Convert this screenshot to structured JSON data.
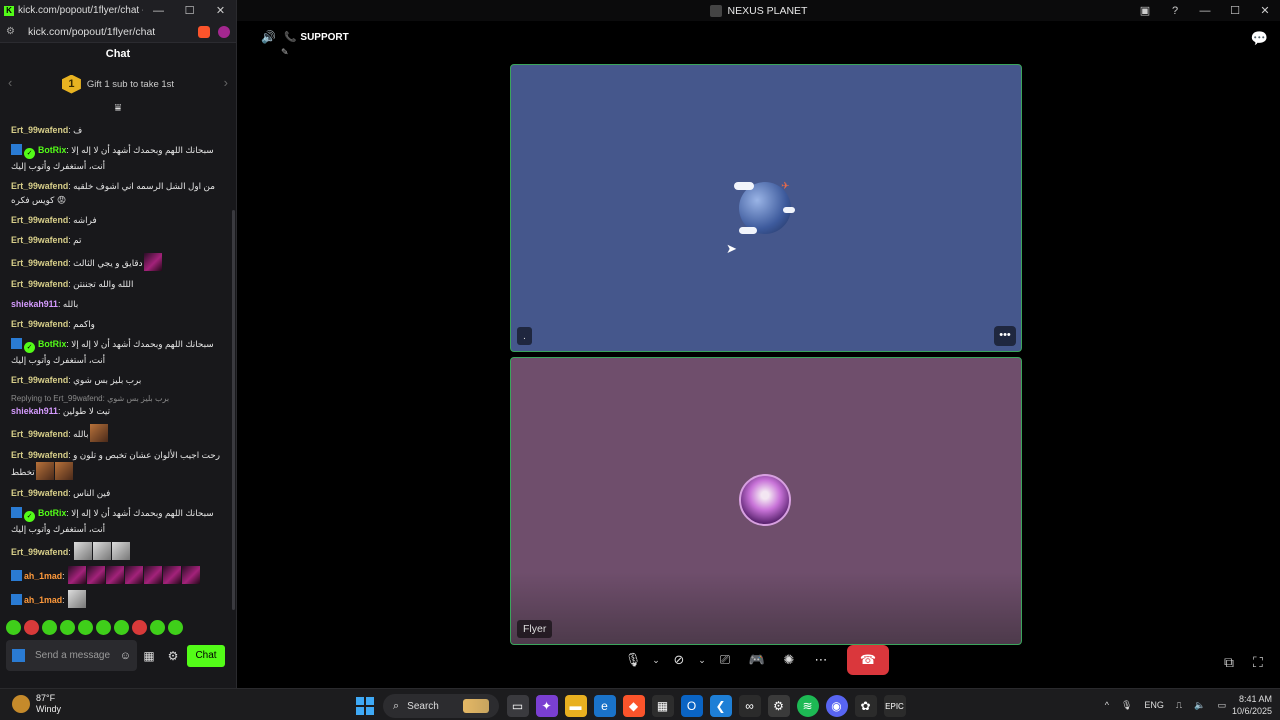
{
  "chat_window": {
    "title": "kick.com/popout/1flyer/chat - Brave",
    "url": "kick.com/popout/1flyer/chat",
    "header": "Chat",
    "pinned": {
      "icon_number": "1",
      "text": "Gift 1 sub to take 1st"
    },
    "messages": [
      {
        "user": "Ert_99wafend",
        "color": "olive",
        "text": "ف"
      },
      {
        "user": "BotRix",
        "color": "bot",
        "text": "سبحانك اللهم وبحمدك أشهد أن لا إله إلا أنت، أستغفرك وأتوب إليك",
        "badges": true
      },
      {
        "user": "Ert_99wafend",
        "color": "olive",
        "text": "من اول الشل الرسمه اني اشوف خلقيه كويس فكره 😡"
      },
      {
        "user": "Ert_99wafend",
        "color": "olive",
        "text": "فراشه"
      },
      {
        "user": "Ert_99wafend",
        "color": "olive",
        "text": "تم"
      },
      {
        "user": "Ert_99wafend",
        "color": "olive",
        "text": "دقايق و يجي الثالث",
        "emotes": 1
      },
      {
        "user": "Ert_99wafend",
        "color": "olive",
        "text": "اللله والله تجننتن"
      },
      {
        "user": "shiekah911",
        "color": "pink",
        "text": "بالله"
      },
      {
        "user": "Ert_99wafend",
        "color": "olive",
        "text": "واكمم"
      },
      {
        "user": "BotRix",
        "color": "bot",
        "text": "سبحانك اللهم وبحمدك أشهد أن لا إله إلا أنت، أستغفرك وأتوب إليك",
        "badges": true
      },
      {
        "user": "Ert_99wafend",
        "color": "olive",
        "text": "برب بليز بس شوي"
      },
      {
        "user": "shiekah911",
        "color": "pink",
        "text": "تيت لا طولين",
        "reply": "Replying to Ert_99wafend: برب بليز بس شوي"
      },
      {
        "user": "Ert_99wafend",
        "color": "olive",
        "text": "بالله",
        "emotes": 1,
        "emote_style": "warm"
      },
      {
        "user": "Ert_99wafend",
        "color": "olive",
        "text": "رحت اجيب الألوان عشان تخبص و تلون و تخطط",
        "emotes": 2,
        "emote_style": "warm"
      },
      {
        "user": "Ert_99wafend",
        "color": "olive",
        "text": "فين الناس"
      },
      {
        "user": "BotRix",
        "color": "bot",
        "text": "سبحانك اللهم وبحمدك أشهد أن لا إله إلا أنت، أستغفرك وأتوب إليك",
        "badges": true
      },
      {
        "user": "Ert_99wafend",
        "color": "olive",
        "text": "",
        "emotes": 3,
        "emote_style": "pale"
      },
      {
        "user": "ah_1mad",
        "color": "orange",
        "text": "",
        "emotes": 7,
        "kick_badge": true
      },
      {
        "user": "ah_1mad",
        "color": "orange",
        "text": "",
        "emotes": 1,
        "emote_style": "pale",
        "kick_badge": true
      },
      {
        "user": "ah_1mad",
        "color": "orange",
        "text": "",
        "emotes": 2,
        "emote_style": "red",
        "kick_badge": true
      }
    ],
    "input_placeholder": "Send a message",
    "send_label": "Chat"
  },
  "discord": {
    "window_title": "NEXUS PLANET",
    "channel": "SUPPORT",
    "tile_user": "Flyer",
    "tile_dot": "."
  },
  "taskbar": {
    "weather_temp": "87°F",
    "weather_desc": "Windy",
    "search_placeholder": "Search",
    "language": "ENG",
    "time": "8:41 AM",
    "date": "10/6/2025"
  },
  "colors": {
    "kick_green": "#53fc18",
    "discord_tile_border": "#3ba55c",
    "hangup_red": "#da373c"
  }
}
